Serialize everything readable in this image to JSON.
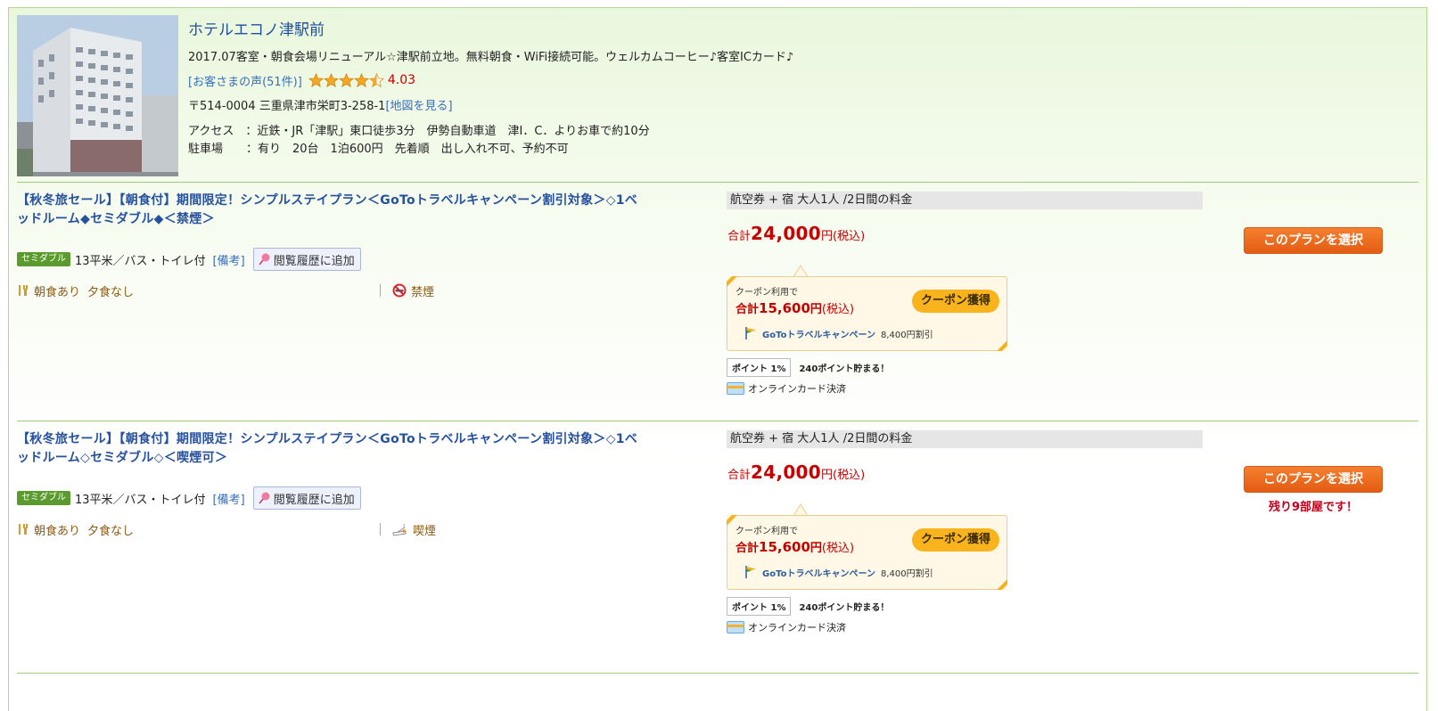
{
  "hotel": {
    "name": "ホテルエコノ津駅前",
    "catchcopy": "2017.07客室・朝食会場リニューアル☆津駅前立地。無料朝食・WiFi接続可能。ウェルカムコーヒー♪客室ICカード♪",
    "reviews_link": "[お客さまの声(51件)]",
    "rating_value": 4.03,
    "rating": "4.03",
    "address": "〒514-0004 三重県津市栄町3-258-1",
    "map_link": "[地図を見る]",
    "access_label": "アクセス　：",
    "access": "近鉄・JR「津駅」東口徒歩3分　伊勢自動車道　津I．C．よりお車で約10分",
    "parking_label": "駐車場　　：",
    "parking": "有り　20台　1泊600円　先着順　出し入れ不可、予約不可"
  },
  "colors": {
    "link": "#1f4f9c",
    "price": "#c40000",
    "select_button": "#e35b12",
    "coupon_button": "#f8b31d",
    "room_badge": "#5b9a2f"
  },
  "plans": [
    {
      "title": "【秋冬旅セール】【朝食付】期間限定！シンプルステイプラン＜GoToトラベルキャンペーン割引対象＞◇1ベッドルーム◆セミダブル◆＜禁煙＞",
      "room_badge": "セミダブル",
      "room_desc": "13平米／バス・トイレ付",
      "biko": "[備考]",
      "history_button": "閲覧履歴に追加",
      "breakfast": "朝食あり",
      "dinner": "夕食なし",
      "smoking": "禁煙",
      "smoking_icon": "no-smoking-icon",
      "price_header": "航空券 + 宿 大人1人 /2日間の料金",
      "total_label": "合計",
      "total": "24,000",
      "yen": "円",
      "tax": "(税込)",
      "select_button": "このプランを選択",
      "rooms_left": "",
      "coupon_note": "クーポン利用で",
      "coupon_total_label": "合計",
      "coupon_total": "15,600",
      "coupon_yen": "円",
      "coupon_tax": "(税込)",
      "coupon_button": "クーポン獲得",
      "goto_name": "GoToトラベルキャンペーン",
      "goto_discount": "8,400円割引",
      "point_badge": "ポイント 1%",
      "point_text": "240ポイント貯まる！",
      "payment": "オンラインカード決済"
    },
    {
      "title": "【秋冬旅セール】【朝食付】期間限定！シンプルステイプラン＜GoToトラベルキャンペーン割引対象＞◇1ベッドルーム◇セミダブル◇＜喫煙可＞",
      "room_badge": "セミダブル",
      "room_desc": "13平米／バス・トイレ付",
      "biko": "[備考]",
      "history_button": "閲覧履歴に追加",
      "breakfast": "朝食あり",
      "dinner": "夕食なし",
      "smoking": "喫煙",
      "smoking_icon": "smoking-icon",
      "price_header": "航空券 + 宿 大人1人 /2日間の料金",
      "total_label": "合計",
      "total": "24,000",
      "yen": "円",
      "tax": "(税込)",
      "select_button": "このプランを選択",
      "rooms_left": "残り9部屋です！",
      "coupon_note": "クーポン利用で",
      "coupon_total_label": "合計",
      "coupon_total": "15,600",
      "coupon_yen": "円",
      "coupon_tax": "(税込)",
      "coupon_button": "クーポン獲得",
      "goto_name": "GoToトラベルキャンペーン",
      "goto_discount": "8,400円割引",
      "point_badge": "ポイント 1%",
      "point_text": "240ポイント貯まる！",
      "payment": "オンラインカード決済"
    }
  ]
}
